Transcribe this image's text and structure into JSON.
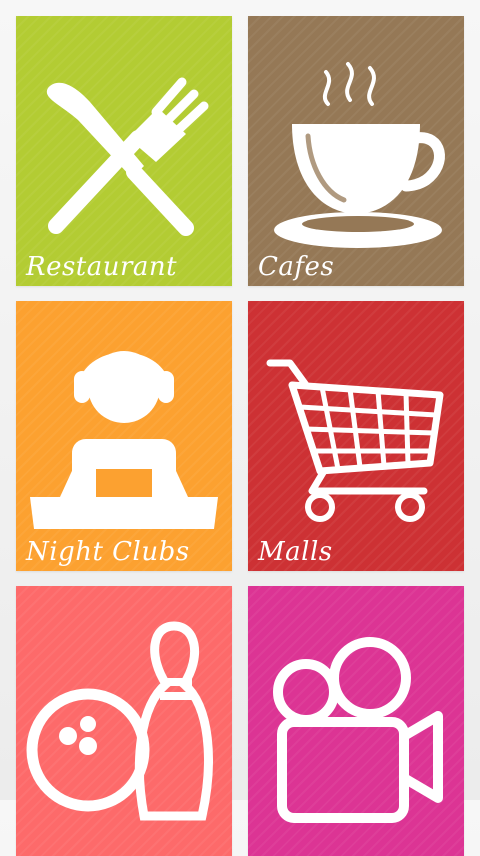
{
  "tiles": [
    {
      "label": "Restaurant",
      "color": "#b3cc33",
      "icon": "fork-knife-icon"
    },
    {
      "label": "Cafes",
      "color": "#957856",
      "icon": "coffee-cup-icon"
    },
    {
      "label": "Night Clubs",
      "color": "#fca130",
      "icon": "dj-headphones-icon"
    },
    {
      "label": "Malls",
      "color": "#cd3134",
      "icon": "shopping-cart-icon"
    },
    {
      "label": "",
      "color": "#fd6a6a",
      "icon": "bowling-icon"
    },
    {
      "label": "",
      "color": "#dc3494",
      "icon": "movie-camera-icon"
    }
  ]
}
